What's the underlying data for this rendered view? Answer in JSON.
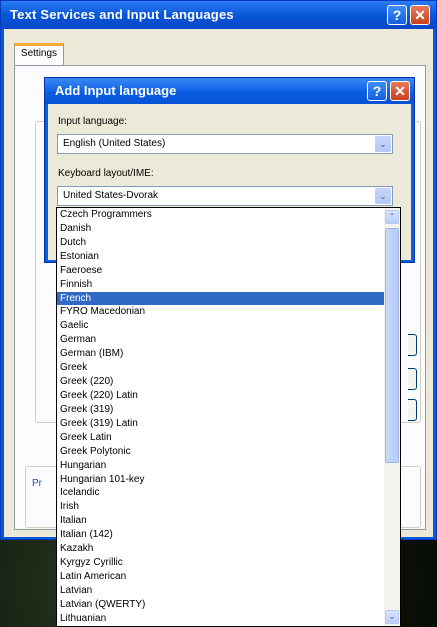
{
  "outer_window": {
    "title": "Text Services and Input Languages",
    "help_glyph": "?",
    "close_glyph": "✕",
    "tab_label": "Settings",
    "pref_label": "Pr"
  },
  "dialog": {
    "title": "Add Input language",
    "help_glyph": "?",
    "close_glyph": "✕",
    "input_language_label": "Input language:",
    "input_language_value": "English (United States)",
    "keyboard_label": "Keyboard layout/IME:",
    "keyboard_value": "United States-Dvorak",
    "arrow_glyph": "⌄"
  },
  "dropdown": {
    "selected_index": 6,
    "scroll_up_glyph": "⌃",
    "scroll_down_glyph": "⌄",
    "items": [
      "Czech Programmers",
      "Danish",
      "Dutch",
      "Estonian",
      "Faeroese",
      "Finnish",
      "French",
      "FYRO Macedonian",
      "Gaelic",
      "German",
      "German (IBM)",
      "Greek",
      "Greek (220)",
      "Greek (220) Latin",
      "Greek (319)",
      "Greek (319) Latin",
      "Greek Latin",
      "Greek Polytonic",
      "Hungarian",
      "Hungarian 101-key",
      "Icelandic",
      "Irish",
      "Italian",
      "Italian (142)",
      "Kazakh",
      "Kyrgyz Cyrillic",
      "Latin American",
      "Latvian",
      "Latvian (QWERTY)",
      "Lithuanian"
    ]
  },
  "colors": {
    "xp_blue": "#0a56d8",
    "selection": "#316ac5",
    "dialog_face": "#ece9d8",
    "close_red": "#c9401d"
  }
}
